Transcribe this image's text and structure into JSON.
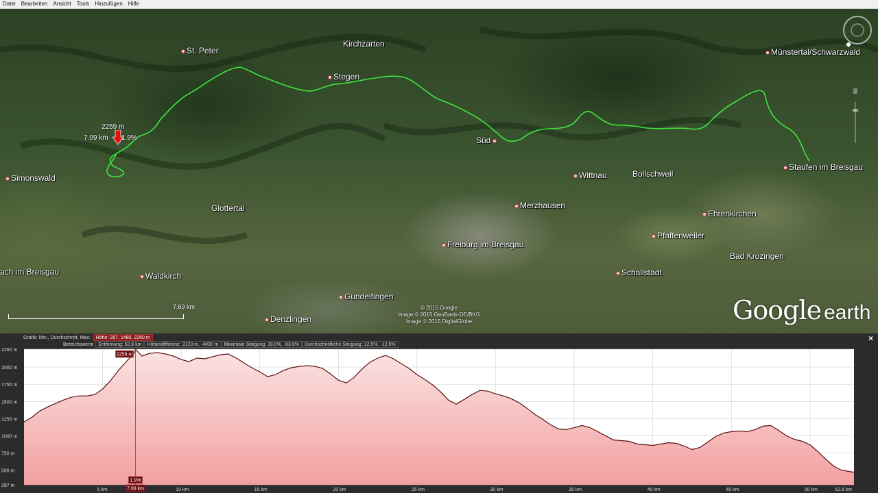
{
  "menu": [
    "Datei",
    "Bearbeiten",
    "Ansicht",
    "Tools",
    "Hinzufügen",
    "Hilfe"
  ],
  "map": {
    "places": [
      {
        "name": "St. Peter"
      },
      {
        "name": "Kirchzarten"
      },
      {
        "name": "Stegen"
      },
      {
        "name": "Münstertal/Schwarzwald"
      },
      {
        "name": "Süd"
      },
      {
        "name": "Staufen im Breisgau"
      },
      {
        "name": "Simonswald"
      },
      {
        "name": "Wittnau"
      },
      {
        "name": "Bollschweil"
      },
      {
        "name": "Glottertal"
      },
      {
        "name": "Merzhausen"
      },
      {
        "name": "Ehrenkirchen"
      },
      {
        "name": "Pfaffenweiler"
      },
      {
        "name": "Freiburg im Breisgau"
      },
      {
        "name": "Bad Krozingen"
      },
      {
        "name": "ach im Breisgau"
      },
      {
        "name": "Waldkirch"
      },
      {
        "name": "Schallstadt"
      },
      {
        "name": "Gundelfingen"
      },
      {
        "name": "Denzlingen"
      }
    ],
    "marker_elevation": "2259 m",
    "marker_distance": "7.09 km",
    "marker_slope": "1.9%",
    "scale_label": "7.69  km",
    "attribution": [
      "© 2015 Google",
      "Image © 2015 GeoBasis-DE/BKG",
      "Image © 2015 DigitalGlobe"
    ],
    "logo_google": "Google",
    "logo_earth": "earth",
    "track_color": "#3ee63e",
    "marker_color": "#e01010"
  },
  "panel": {
    "close_icon": "×",
    "row1": {
      "label": "Grafik: Min., Durchschnitt, Max:",
      "box": "Höhe: 287, 1480, 2260 m"
    },
    "row2": {
      "label": "Bereichswerte",
      "boxes": [
        "Entfernung: 52.8 km",
        "Höhendifferenz: 3123 m, -4030 m",
        "Maximale Steigung: 39.0%, -83.9%",
        "Durchschnittliche Steigung: 12.5%, -12.5%"
      ]
    },
    "cursor_elevation": "2259 m",
    "cursor_slope": "1.9%",
    "cursor_distance": "7.09 km"
  },
  "chart_data": {
    "type": "area",
    "title": "",
    "xlabel": "",
    "ylabel": "",
    "xlim": [
      0,
      52.8
    ],
    "ylim": [
      287,
      2260
    ],
    "x_ticks": [
      {
        "value": 5,
        "label": "5 km"
      },
      {
        "value": 10,
        "label": "10 km"
      },
      {
        "value": 15,
        "label": "15 km"
      },
      {
        "value": 20,
        "label": "20 km"
      },
      {
        "value": 25,
        "label": "25 km"
      },
      {
        "value": 30,
        "label": "30 km"
      },
      {
        "value": 35,
        "label": "35 km"
      },
      {
        "value": 40,
        "label": "40 km"
      },
      {
        "value": 45,
        "label": "45 km"
      },
      {
        "value": 50,
        "label": "50 km"
      },
      {
        "value": 52.8,
        "label": "52.8 km"
      }
    ],
    "y_ticks": [
      {
        "value": 287,
        "label": "287 m"
      },
      {
        "value": 500,
        "label": "500 m"
      },
      {
        "value": 750,
        "label": "750 m"
      },
      {
        "value": 1000,
        "label": "1000 m"
      },
      {
        "value": 1250,
        "label": "1250 m"
      },
      {
        "value": 1500,
        "label": "1500 m"
      },
      {
        "value": 1750,
        "label": "1750 m"
      },
      {
        "value": 2000,
        "label": "2000 m"
      },
      {
        "value": 2260,
        "label": "2260 m"
      }
    ],
    "grid": true,
    "line_color": "#5a1010",
    "fill_top": "#fbe3e3",
    "fill_bottom": "#f2a0a0",
    "cursor_x": 7.09,
    "x": [
      0,
      0.5,
      1,
      1.5,
      2,
      2.5,
      3,
      3.5,
      4,
      4.5,
      5,
      5.5,
      6,
      6.5,
      7,
      7.09,
      7.5,
      8,
      8.5,
      9,
      9.5,
      10,
      10.5,
      11,
      11.5,
      12,
      12.5,
      13,
      13.5,
      14,
      14.5,
      15,
      15.5,
      16,
      16.5,
      17,
      17.5,
      18,
      18.5,
      19,
      19.5,
      20,
      20.5,
      21,
      21.5,
      22,
      22.5,
      23,
      23.5,
      24,
      24.5,
      25,
      25.5,
      26,
      26.5,
      27,
      27.5,
      28,
      28.5,
      29,
      29.5,
      30,
      30.5,
      31,
      31.5,
      32,
      32.5,
      33,
      33.5,
      34,
      34.5,
      35,
      35.5,
      36,
      36.5,
      37,
      37.5,
      38,
      38.5,
      39,
      39.5,
      40,
      40.5,
      41,
      41.5,
      42,
      42.5,
      43,
      43.5,
      44,
      44.5,
      45,
      45.5,
      46,
      46.5,
      47,
      47.5,
      48,
      48.5,
      49,
      49.5,
      50,
      50.5,
      51,
      51.5,
      52,
      52.5,
      52.8
    ],
    "y": [
      1200,
      1270,
      1360,
      1420,
      1470,
      1520,
      1560,
      1580,
      1580,
      1600,
      1680,
      1800,
      1950,
      2080,
      2200,
      2259,
      2160,
      2200,
      2210,
      2190,
      2160,
      2110,
      2080,
      2130,
      2120,
      2150,
      2180,
      2190,
      2130,
      2060,
      1990,
      1930,
      1860,
      1890,
      1950,
      1990,
      2010,
      2020,
      2010,
      1980,
      1900,
      1810,
      1770,
      1850,
      1970,
      2070,
      2130,
      2170,
      2120,
      2050,
      1980,
      1890,
      1820,
      1740,
      1640,
      1520,
      1460,
      1530,
      1600,
      1660,
      1650,
      1610,
      1580,
      1540,
      1480,
      1400,
      1310,
      1240,
      1160,
      1100,
      1090,
      1120,
      1150,
      1120,
      1060,
      1000,
      940,
      930,
      920,
      880,
      870,
      860,
      880,
      900,
      890,
      850,
      800,
      830,
      910,
      990,
      1040,
      1060,
      1070,
      1060,
      1090,
      1140,
      1150,
      1080,
      1000,
      950,
      920,
      870,
      770,
      660,
      560,
      500,
      480,
      470,
      410,
      330
    ]
  }
}
